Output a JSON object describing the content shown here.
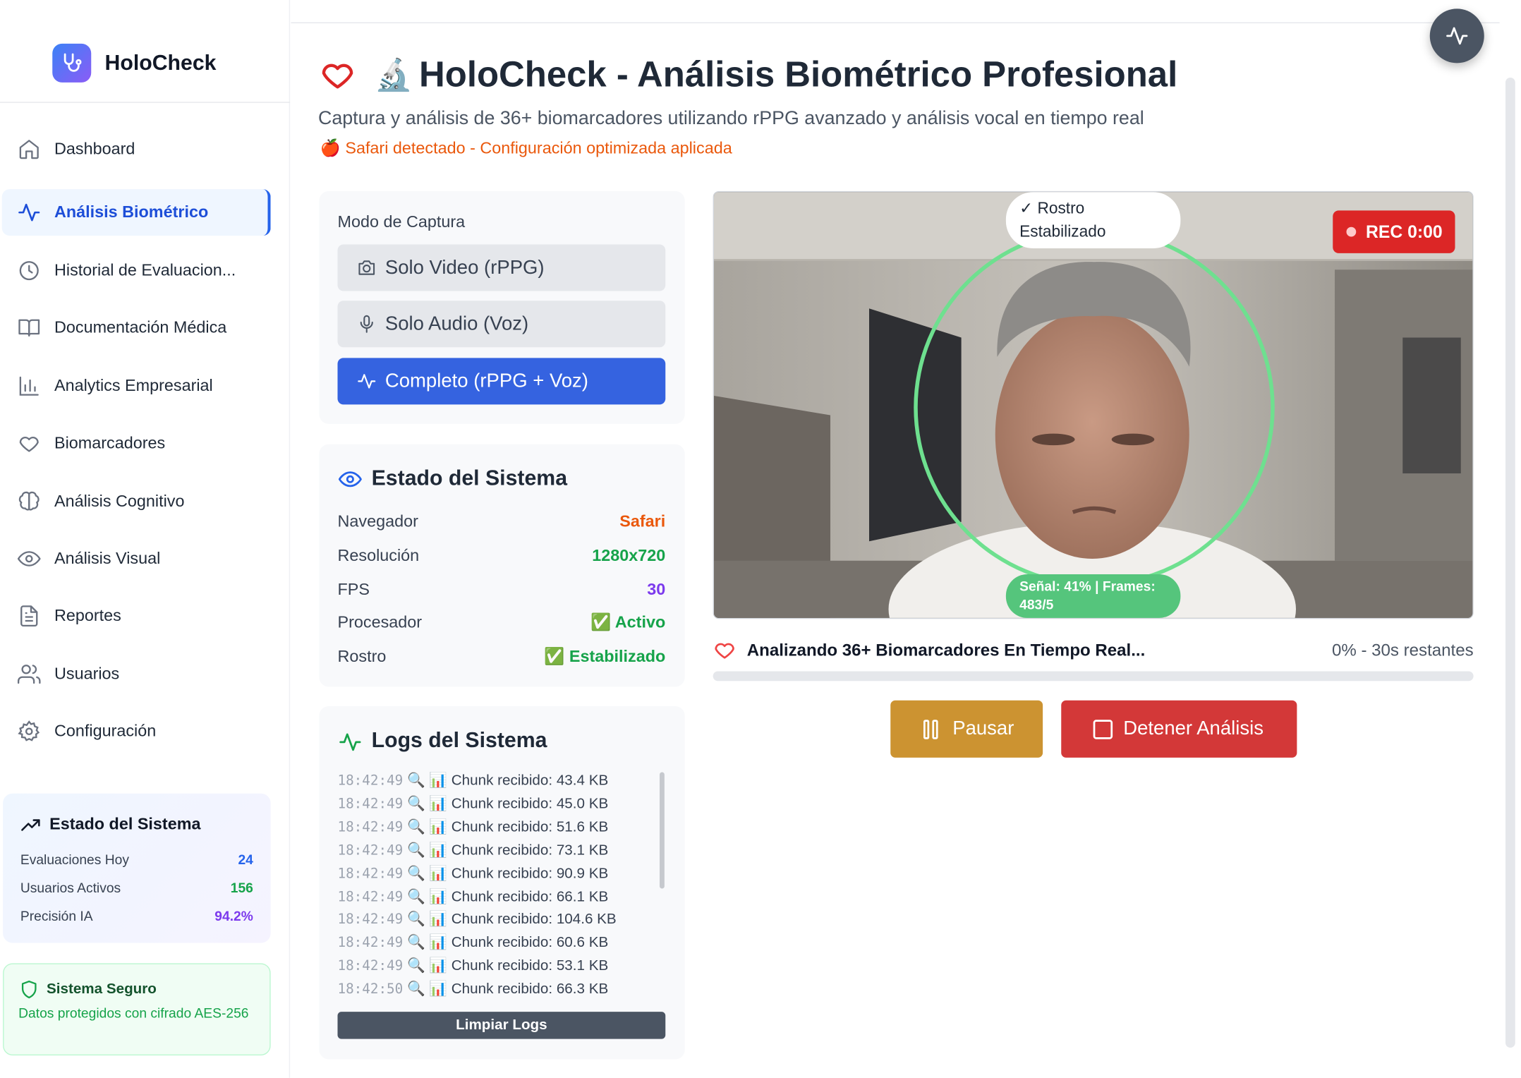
{
  "brand": {
    "name": "HoloCheck"
  },
  "sidebar": {
    "items": [
      {
        "label": "Dashboard",
        "icon": "home-icon",
        "active": false
      },
      {
        "label": "Análisis Biométrico",
        "icon": "activity-icon",
        "active": true
      },
      {
        "label": "Historial de Evaluacion...",
        "icon": "clock-icon",
        "active": false
      },
      {
        "label": "Documentación Médica",
        "icon": "book-icon",
        "active": false
      },
      {
        "label": "Analytics Empresarial",
        "icon": "bar-chart-icon",
        "active": false
      },
      {
        "label": "Biomarcadores",
        "icon": "heart-icon",
        "active": false
      },
      {
        "label": "Análisis Cognitivo",
        "icon": "brain-icon",
        "active": false
      },
      {
        "label": "Análisis Visual",
        "icon": "eye-icon",
        "active": false
      },
      {
        "label": "Reportes",
        "icon": "file-text-icon",
        "active": false
      },
      {
        "label": "Usuarios",
        "icon": "users-icon",
        "active": false
      },
      {
        "label": "Configuración",
        "icon": "gear-icon",
        "active": false
      }
    ],
    "stats": {
      "title": "Estado del Sistema",
      "rows": [
        {
          "label": "Evaluaciones Hoy",
          "value": "24",
          "color": "#2563eb"
        },
        {
          "label": "Usuarios Activos",
          "value": "156",
          "color": "#16a34a"
        },
        {
          "label": "Precisión IA",
          "value": "94.2%",
          "color": "#7c3aed"
        }
      ]
    },
    "secure": {
      "title": "Sistema Seguro",
      "description": "Datos protegidos con cifrado AES-256"
    }
  },
  "header": {
    "title": "HoloCheck - Análisis Biométrico Profesional",
    "subtitle": "Captura y análisis de 36+ biomarcadores utilizando rPPG avanzado y análisis vocal en tiempo real",
    "notice": "🍎 Safari detectado - Configuración optimizada aplicada",
    "emoji": "🔬"
  },
  "capture_mode": {
    "title": "Modo de Captura",
    "options": [
      {
        "label": "Solo Video (rPPG)",
        "icon": "camera-icon",
        "selected": false
      },
      {
        "label": "Solo Audio (Voz)",
        "icon": "microphone-icon",
        "selected": false
      },
      {
        "label": "Completo (rPPG + Voz)",
        "icon": "activity-icon",
        "selected": true
      }
    ]
  },
  "system_state": {
    "title": "Estado del Sistema",
    "rows": [
      {
        "label": "Navegador",
        "value": "Safari",
        "color": "#ea580c"
      },
      {
        "label": "Resolución",
        "value": "1280x720",
        "color": "#16a34a"
      },
      {
        "label": "FPS",
        "value": "30",
        "color": "#7c3aed"
      },
      {
        "label": "Procesador",
        "value": "✅ Activo",
        "color": "#16a34a"
      },
      {
        "label": "Rostro",
        "value": "✅ Estabilizado",
        "color": "#16a34a"
      }
    ]
  },
  "logs": {
    "title": "Logs del Sistema",
    "entries": [
      {
        "time": "18:42:49",
        "message": "🔍 📊 Chunk recibido: 43.4 KB"
      },
      {
        "time": "18:42:49",
        "message": "🔍 📊 Chunk recibido: 45.0 KB"
      },
      {
        "time": "18:42:49",
        "message": "🔍 📊 Chunk recibido: 51.6 KB"
      },
      {
        "time": "18:42:49",
        "message": "🔍 📊 Chunk recibido: 73.1 KB"
      },
      {
        "time": "18:42:49",
        "message": "🔍 📊 Chunk recibido: 90.9 KB"
      },
      {
        "time": "18:42:49",
        "message": "🔍 📊 Chunk recibido: 66.1 KB"
      },
      {
        "time": "18:42:49",
        "message": "🔍 📊 Chunk recibido: 104.6 KB"
      },
      {
        "time": "18:42:49",
        "message": "🔍 📊 Chunk recibido: 60.6 KB"
      },
      {
        "time": "18:42:49",
        "message": "🔍 📊 Chunk recibido: 53.1 KB"
      },
      {
        "time": "18:42:50",
        "message": "🔍 📊 Chunk recibido: 66.3 KB"
      }
    ],
    "clear_label": "Limpiar Logs"
  },
  "video": {
    "face_status": "✓ Rostro Estabilizado",
    "signal_status": "Señal: 41% | Frames: 483/5",
    "rec_label": "REC 0:00"
  },
  "analysis": {
    "label": "Analizando 36+ Biomarcadores En Tiempo Real...",
    "progress_text": "0% - 30s restantes",
    "progress_fraction": 0.0
  },
  "controls": {
    "pause_label": "Pausar",
    "stop_label": "Detener Análisis"
  }
}
